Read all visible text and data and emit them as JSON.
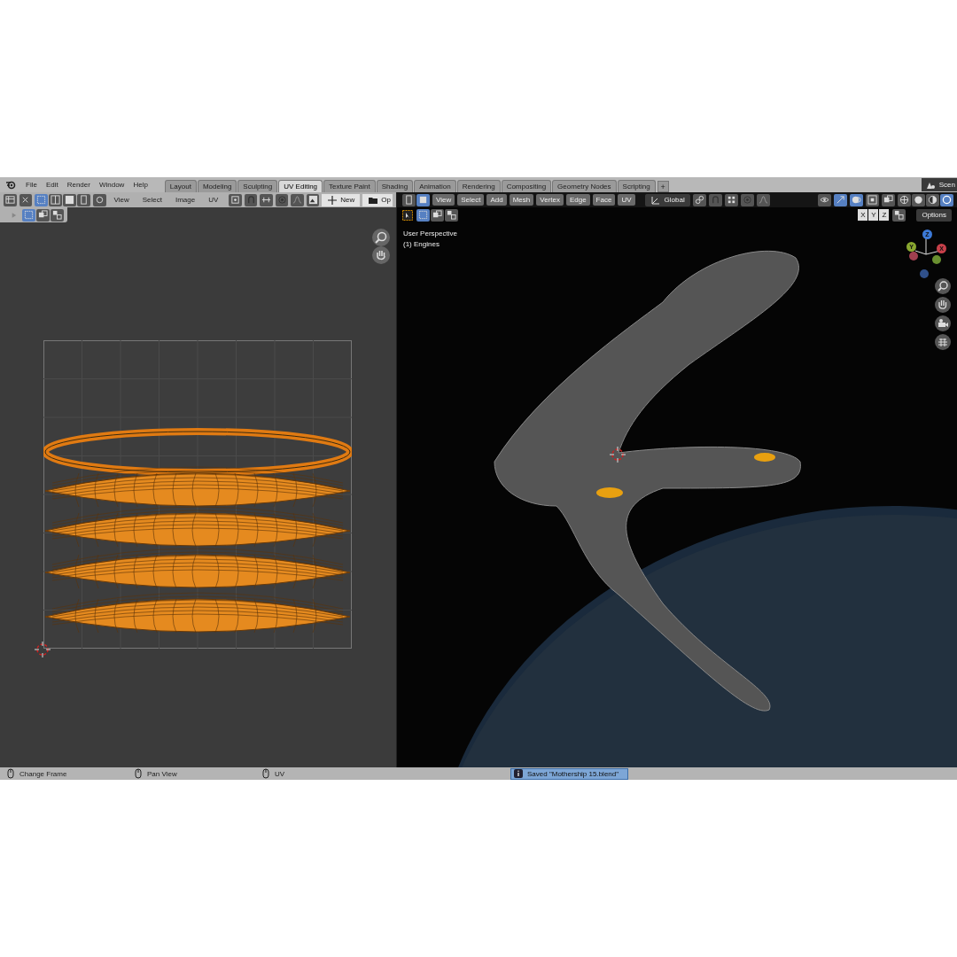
{
  "menu": [
    "File",
    "Edit",
    "Render",
    "Window",
    "Help"
  ],
  "workspace_tabs": [
    {
      "label": "Layout",
      "selected": false
    },
    {
      "label": "Modeling",
      "selected": false
    },
    {
      "label": "Sculpting",
      "selected": false
    },
    {
      "label": "UV Editing",
      "selected": true
    },
    {
      "label": "Texture Paint",
      "selected": false
    },
    {
      "label": "Shading",
      "selected": false
    },
    {
      "label": "Animation",
      "selected": false
    },
    {
      "label": "Rendering",
      "selected": false
    },
    {
      "label": "Compositing",
      "selected": false
    },
    {
      "label": "Geometry Nodes",
      "selected": false
    },
    {
      "label": "Scripting",
      "selected": false
    }
  ],
  "add_tab": "+",
  "scene": "Scen",
  "uv_editor": {
    "select_modes": [
      {
        "selected": true
      },
      {
        "selected": false
      },
      {
        "selected": false
      },
      {
        "selected": false
      }
    ],
    "menus": [
      "View",
      "Select",
      "Image",
      "UV"
    ],
    "new_button": "New",
    "open_button": "Op",
    "island_modes": [
      {
        "selected": true
      },
      {
        "selected": false
      },
      {
        "selected": false
      }
    ]
  },
  "viewport": {
    "select_modes": [
      {
        "selected": true
      },
      {
        "selected": false
      },
      {
        "selected": false
      }
    ],
    "menus": [
      "View",
      "Select",
      "Add",
      "Mesh",
      "Vertex",
      "Edge",
      "Face",
      "UV"
    ],
    "orientation": "Global",
    "shading_modes": [
      {
        "selected": false
      },
      {
        "selected": false
      },
      {
        "selected": false
      },
      {
        "selected": true
      }
    ],
    "axes": [
      "X",
      "Y",
      "Z"
    ],
    "options": "Options",
    "view_name": "User Perspective",
    "object_name": "(1) Engines",
    "gizmo": [
      "Z",
      "Y",
      "X"
    ]
  },
  "status_bar": {
    "hints": [
      "Change Frame",
      "Pan View",
      "UV"
    ],
    "report": "Saved \"Mothership 15.blend\""
  }
}
